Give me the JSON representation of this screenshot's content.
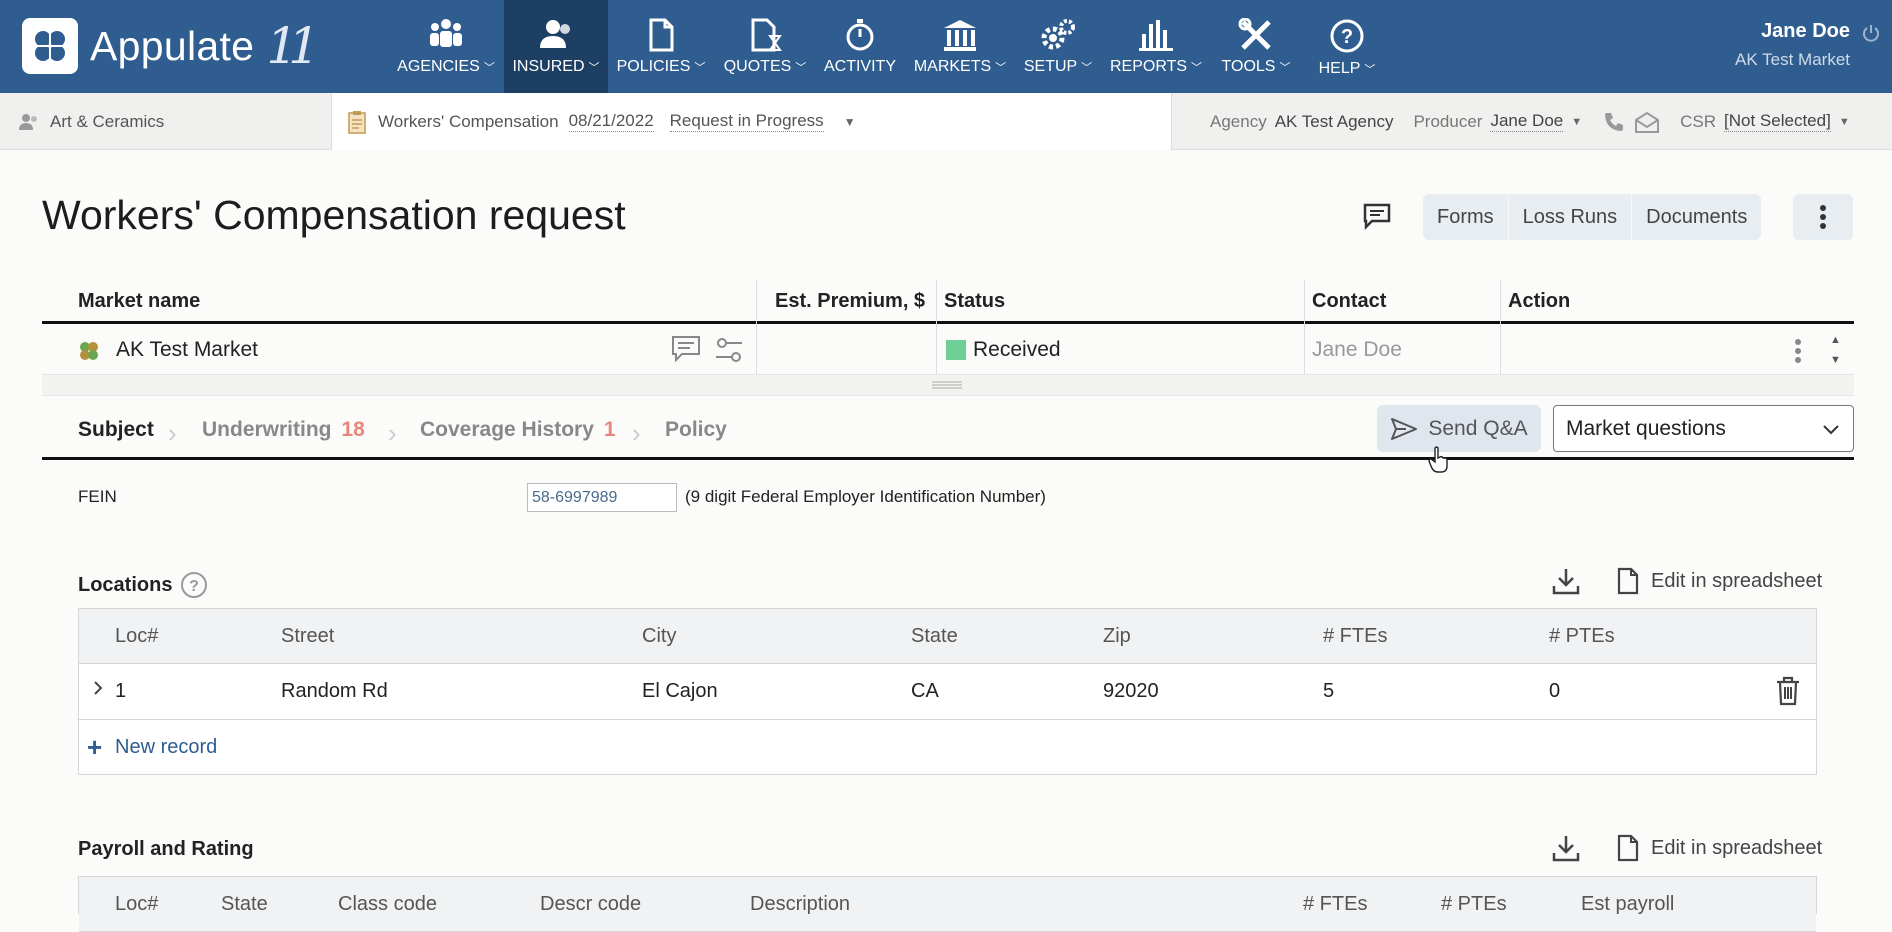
{
  "app": {
    "brand": "Appulate",
    "version": "11"
  },
  "nav": {
    "items": [
      {
        "label": "AGENCIES",
        "icon": "people-group-icon",
        "chevron": true
      },
      {
        "label": "INSURED",
        "icon": "person-icon",
        "chevron": true,
        "active": true
      },
      {
        "label": "POLICIES",
        "icon": "document-icon",
        "chevron": true
      },
      {
        "label": "QUOTES",
        "icon": "document-hourglass-icon",
        "chevron": true
      },
      {
        "label": "ACTIVITY",
        "icon": "stopwatch-icon",
        "chevron": false
      },
      {
        "label": "MARKETS",
        "icon": "bank-icon",
        "chevron": true
      },
      {
        "label": "SETUP",
        "icon": "gears-icon",
        "chevron": true
      },
      {
        "label": "REPORTS",
        "icon": "bar-chart-icon",
        "chevron": true
      },
      {
        "label": "TOOLS",
        "icon": "tools-icon",
        "chevron": true
      },
      {
        "label": "HELP",
        "icon": "question-circle-icon",
        "chevron": true
      }
    ]
  },
  "user": {
    "name": "Jane Doe",
    "market": "AK Test Market"
  },
  "subbar": {
    "insured": "Art & Ceramics",
    "policy_type": "Workers' Compensation",
    "policy_date": "08/21/2022",
    "policy_status": "Request in Progress",
    "agency_label": "Agency",
    "agency_value": "AK Test Agency",
    "producer_label": "Producer",
    "producer_value": "Jane Doe",
    "csr_label": "CSR",
    "csr_value": "[Not Selected]"
  },
  "page": {
    "title": "Workers' Compensation request",
    "buttons": {
      "forms": "Forms",
      "loss_runs": "Loss Runs",
      "documents": "Documents"
    }
  },
  "market_table": {
    "headers": {
      "market": "Market name",
      "premium": "Est. Premium, $",
      "status": "Status",
      "contact": "Contact",
      "action": "Action"
    },
    "row": {
      "market": "AK Test Market",
      "premium": "",
      "status": "Received",
      "status_color": "#6fcf97",
      "contact": "Jane Doe"
    }
  },
  "tabs": [
    {
      "label": "Subject",
      "count": ""
    },
    {
      "label": "Underwriting",
      "count": "18"
    },
    {
      "label": "Coverage History",
      "count": "1"
    },
    {
      "label": "Policy",
      "count": ""
    }
  ],
  "send_qa": "Send Q&A",
  "market_questions": "Market questions",
  "fein": {
    "label": "FEIN",
    "value": "58-6997989",
    "hint": "(9 digit Federal Employer Identification Number)"
  },
  "locations": {
    "title": "Locations",
    "edit": "Edit in spreadsheet",
    "headers": [
      "Loc#",
      "Street",
      "City",
      "State",
      "Zip",
      "# FTEs",
      "# PTEs"
    ],
    "rows": [
      [
        "1",
        "Random Rd",
        "El Cajon",
        "CA",
        "92020",
        "5",
        "0"
      ]
    ],
    "new_record": "New record"
  },
  "payroll": {
    "title": "Payroll and Rating",
    "edit": "Edit in spreadsheet",
    "headers": [
      "Loc#",
      "State",
      "Class code",
      "Descr code",
      "Description",
      "# FTEs",
      "# PTEs",
      "Est payroll"
    ]
  },
  "colors": {
    "nav_bg": "#2f5d8f",
    "nav_active": "#1d3f64",
    "accent": "#2f5d8f",
    "count": "#e8867e"
  }
}
